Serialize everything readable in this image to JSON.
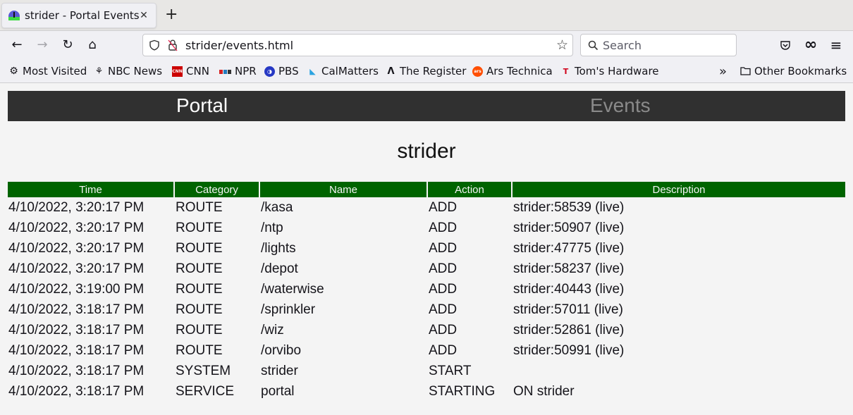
{
  "browser": {
    "tab": {
      "title": "strider - Portal Events",
      "close_icon": "close-icon"
    },
    "new_tab_label": "+",
    "nav": {
      "back_icon": "←",
      "forward_icon": "→",
      "reload_icon": "↻",
      "home_icon": "⌂"
    },
    "url": "strider/events.html",
    "bookmark_star_icon": "☆",
    "search_placeholder": "Search",
    "toolbar_icons": {
      "pocket": "⌵",
      "extension": "∞",
      "menu": "≡"
    },
    "bookmarks": [
      {
        "label": "Most Visited",
        "icon": "⚙"
      },
      {
        "label": "NBC News",
        "icon": "⚘"
      },
      {
        "label": "CNN",
        "icon": "CNN"
      },
      {
        "label": "NPR",
        "icon": "npr"
      },
      {
        "label": "PBS",
        "icon": "◑"
      },
      {
        "label": "CalMatters",
        "icon": "◣"
      },
      {
        "label": "The Register",
        "icon": "Ʌ"
      },
      {
        "label": "Ars Technica",
        "icon": "ars"
      },
      {
        "label": "Tom's Hardware",
        "icon": "T"
      }
    ],
    "overflow_label": "»",
    "other_bookmarks": {
      "label": "Other Bookmarks",
      "icon": "🗀"
    }
  },
  "page": {
    "nav": {
      "portal": "Portal",
      "events": "Events"
    },
    "title": "strider",
    "table": {
      "headers": [
        "Time",
        "Category",
        "Name",
        "Action",
        "Description"
      ],
      "rows": [
        [
          "4/10/2022, 3:20:17 PM",
          "ROUTE",
          "/kasa",
          "ADD",
          "strider:58539 (live)"
        ],
        [
          "4/10/2022, 3:20:17 PM",
          "ROUTE",
          "/ntp",
          "ADD",
          "strider:50907 (live)"
        ],
        [
          "4/10/2022, 3:20:17 PM",
          "ROUTE",
          "/lights",
          "ADD",
          "strider:47775 (live)"
        ],
        [
          "4/10/2022, 3:20:17 PM",
          "ROUTE",
          "/depot",
          "ADD",
          "strider:58237 (live)"
        ],
        [
          "4/10/2022, 3:19:00 PM",
          "ROUTE",
          "/waterwise",
          "ADD",
          "strider:40443 (live)"
        ],
        [
          "4/10/2022, 3:18:17 PM",
          "ROUTE",
          "/sprinkler",
          "ADD",
          "strider:57011 (live)"
        ],
        [
          "4/10/2022, 3:18:17 PM",
          "ROUTE",
          "/wiz",
          "ADD",
          "strider:52861 (live)"
        ],
        [
          "4/10/2022, 3:18:17 PM",
          "ROUTE",
          "/orvibo",
          "ADD",
          "strider:50991 (live)"
        ],
        [
          "4/10/2022, 3:18:17 PM",
          "SYSTEM",
          "strider",
          "START",
          ""
        ],
        [
          "4/10/2022, 3:18:17 PM",
          "SERVICE",
          "portal",
          "STARTING",
          "ON strider"
        ]
      ]
    }
  },
  "colors": {
    "header_green": "#006400",
    "nav_bg": "#303030",
    "nav_active": "#ffffff",
    "nav_inactive": "#8a8a8a",
    "page_bg": "#f4f4f4"
  }
}
